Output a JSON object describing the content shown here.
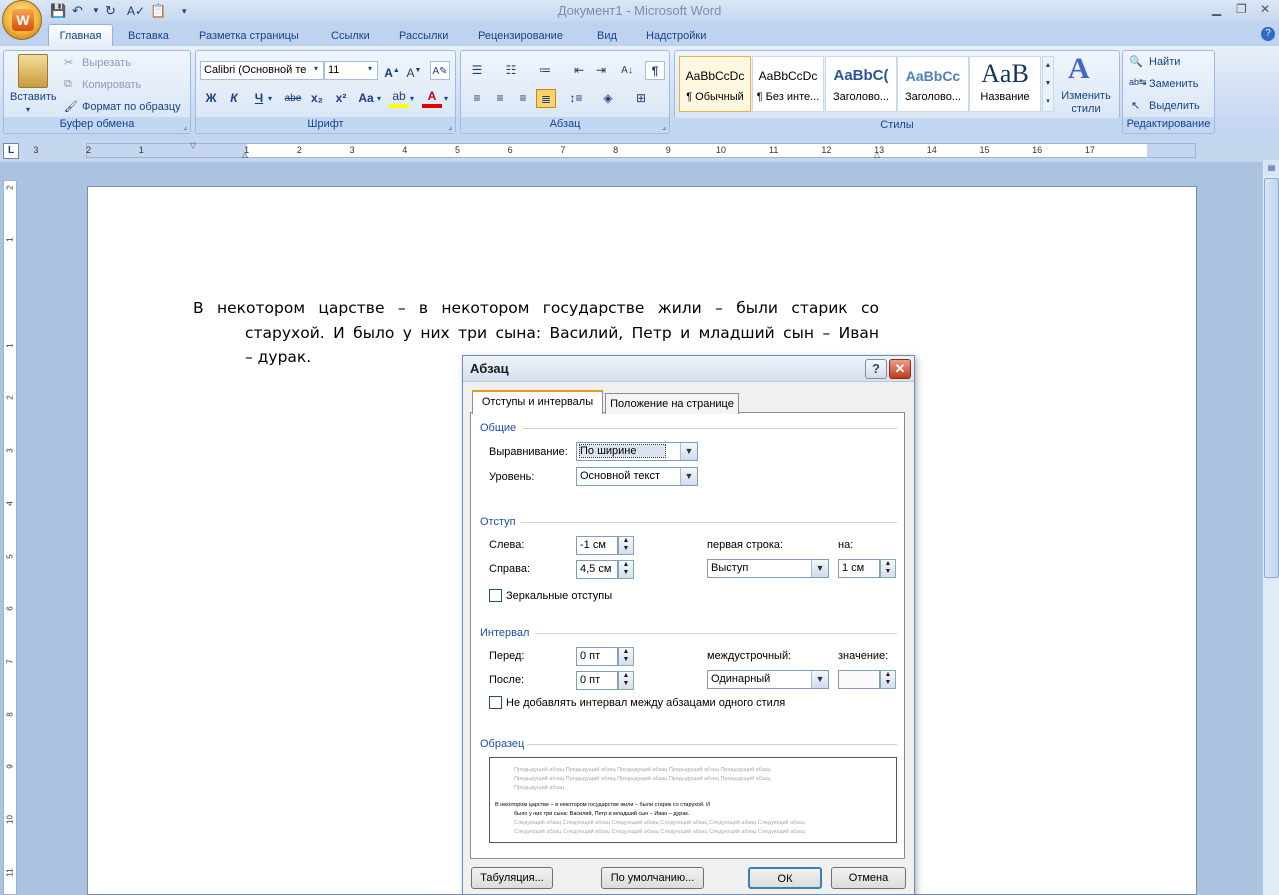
{
  "window": {
    "title": "Документ1 - Microsoft Word"
  },
  "tabs": [
    "Главная",
    "Вставка",
    "Разметка страницы",
    "Ссылки",
    "Рассылки",
    "Рецензирование",
    "Вид",
    "Надстройки"
  ],
  "clipboard": {
    "paste": "Вставить",
    "cut": "Вырезать",
    "copy": "Копировать",
    "format_painter": "Формат по образцу",
    "label": "Буфер обмена"
  },
  "font": {
    "name": "Calibri (Основной те",
    "size": "11",
    "label": "Шрифт",
    "bold": "Ж",
    "italic": "К",
    "underline": "Ч",
    "strike": "abe",
    "sub": "x₂",
    "sup": "x²",
    "case": "Aa"
  },
  "paragraph": {
    "label": "Абзац"
  },
  "styles": {
    "label": "Стилы",
    "items": [
      {
        "preview": "AaBbCcDc",
        "name": "¶ Обычный"
      },
      {
        "preview": "AaBbCcDc",
        "name": "¶ Без инте..."
      },
      {
        "preview": "AaBbC(",
        "name": "Заголово..."
      },
      {
        "preview": "AaBbCc",
        "name": "Заголово..."
      },
      {
        "preview": "AaB",
        "name": "Название"
      }
    ],
    "change": "Изменить стили"
  },
  "editing": {
    "find": "Найти",
    "replace": "Заменить",
    "select": "Выделить",
    "label": "Редактирование"
  },
  "ruler": {
    "ticks": [
      "3",
      "2",
      "1",
      "1",
      "2",
      "3",
      "4",
      "5",
      "6",
      "7",
      "8",
      "9",
      "10",
      "11",
      "12",
      "13",
      "14",
      "15",
      "16",
      "17"
    ]
  },
  "vruler": {
    "ticks": [
      "2",
      "1",
      "1",
      "2",
      "3",
      "4",
      "5",
      "6",
      "7",
      "8",
      "9",
      "10",
      "11"
    ]
  },
  "document": {
    "text": "В некотором царстве – в некотором государстве жили – были старик со старухой. И было у них три сына: Василий, Петр и младший сын – Иван – дурак."
  },
  "dialog": {
    "title": "Абзац",
    "help": "?",
    "close": "✕",
    "tabs": [
      "Отступы и интервалы",
      "Положение на странице"
    ],
    "general": {
      "section": "Общие",
      "align_label": "Выравнивание:",
      "align_value": "По ширине",
      "level_label": "Уровень:",
      "level_value": "Основной текст"
    },
    "indent": {
      "section": "Отступ",
      "left_label": "Слева:",
      "left_value": "-1 см",
      "right_label": "Справа:",
      "right_value": "4,5 см",
      "first_label": "первая строка:",
      "first_value": "Выступ",
      "by_label": "на:",
      "by_value": "1 см",
      "mirror_label": "Зеркальные отступы"
    },
    "spacing": {
      "section": "Интервал",
      "before_label": "Перед:",
      "before_value": "0 пт",
      "after_label": "После:",
      "after_value": "0 пт",
      "line_label": "междустрочный:",
      "line_value": "Одинарный",
      "value_label": "значение:",
      "value_value": "",
      "no_add_label": "Не добавлять интервал между абзацами одного стиля"
    },
    "sample": {
      "section": "Образец",
      "prev_lines": [
        "Предыдущий абзац Предыдущий абзац Предыдущий абзац Предыдущий абзац Предыдущий абзац",
        "Предыдущий абзац Предыдущий абзац Предыдущий абзац Предыдущий абзац Предыдущий абзац",
        "Предыдущий абзац"
      ],
      "cur_lines": [
        "В  некотором  царстве – в некотором государстве жили – были старик со старухой. И",
        "было у них три сына: Василий, Петр и младший сын – Иван – дурак."
      ],
      "next_lines": [
        "Следующий абзац Следующий абзац Следующий абзац Следующий абзац Следующий абзац Следующий абзац",
        "Следующий абзац Следующий абзац Следующий абзац Следующий абзац Следующий абзац Следующий абзац"
      ]
    },
    "buttons": {
      "tabs": "Табуляция...",
      "default": "По умолчанию...",
      "ok": "ОК",
      "cancel": "Отмена"
    }
  }
}
